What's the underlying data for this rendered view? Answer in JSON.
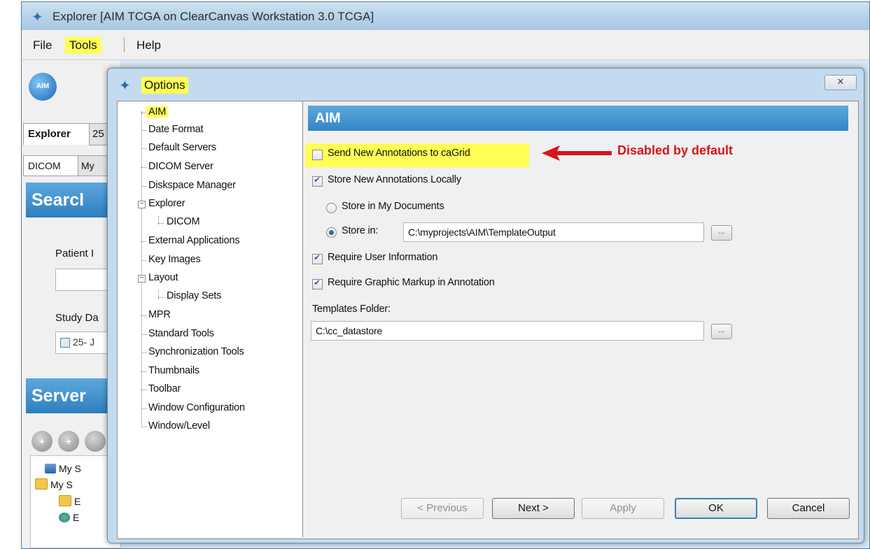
{
  "main_window": {
    "title": "Explorer [AIM TCGA on ClearCanvas Workstation 3.0 TCGA]",
    "menu": {
      "file": "File",
      "tools": "Tools",
      "help": "Help"
    },
    "logo_text": "AIM",
    "tabs": {
      "explorer": "Explorer",
      "second": "25",
      "dicom": "DICOM",
      "my": "My"
    },
    "search_header": "Searcl",
    "patient_label": "Patient I",
    "study_label": "Study Da",
    "study_date_value": "25- J",
    "server_header": "Server",
    "server_tree": [
      {
        "label": "My S",
        "icon": "server-icon"
      },
      {
        "label": "My S",
        "icon": "folder-icon"
      },
      {
        "label": "E",
        "icon": "folder-icon"
      },
      {
        "label": "E",
        "icon": "globe-icon"
      }
    ]
  },
  "dialog": {
    "title": "Options",
    "close_glyph": "✕",
    "tree": [
      {
        "label": "AIM",
        "selected": true
      },
      {
        "label": "Date Format"
      },
      {
        "label": "Default Servers"
      },
      {
        "label": "DICOM Server"
      },
      {
        "label": "Diskspace Manager"
      },
      {
        "label": "Explorer",
        "expander": "-"
      },
      {
        "label": "DICOM",
        "child": true
      },
      {
        "label": "External Applications"
      },
      {
        "label": "Key Images"
      },
      {
        "label": "Layout",
        "expander": "-"
      },
      {
        "label": "Display Sets",
        "child": true
      },
      {
        "label": "MPR"
      },
      {
        "label": "Standard Tools"
      },
      {
        "label": "Synchronization Tools"
      },
      {
        "label": "Thumbnails"
      },
      {
        "label": "Toolbar"
      },
      {
        "label": "Window Configuration"
      },
      {
        "label": "Window/Level"
      }
    ],
    "panel": {
      "header": "AIM",
      "send_to_cagrid": {
        "label": "Send New Annotations to caGrid",
        "checked": false
      },
      "store_locally": {
        "label": "Store New Annotations Locally",
        "checked": true
      },
      "store_in_my_documents": {
        "label": "Store in My Documents",
        "selected": false
      },
      "store_in": {
        "label": "Store in:",
        "selected": true,
        "path": "C:\\myprojects\\AIM\\TemplateOutput"
      },
      "require_user_info": {
        "label": "Require User Information",
        "checked": true
      },
      "require_graphic_markup": {
        "label": "Require Graphic Markup in Annotation",
        "checked": true
      },
      "templates_folder_label": "Templates Folder:",
      "templates_folder_value": "C:\\cc_datastore",
      "browse_label": "..."
    },
    "annotation": {
      "text": "Disabled by default",
      "color": "#d8141b"
    },
    "buttons": {
      "previous": "< Previous",
      "next": "Next >",
      "apply": "Apply",
      "ok": "OK",
      "cancel": "Cancel"
    }
  },
  "colors": {
    "highlight": "#ffff55",
    "header_blue": "#3385c6",
    "arrow_red": "#d8141b"
  }
}
